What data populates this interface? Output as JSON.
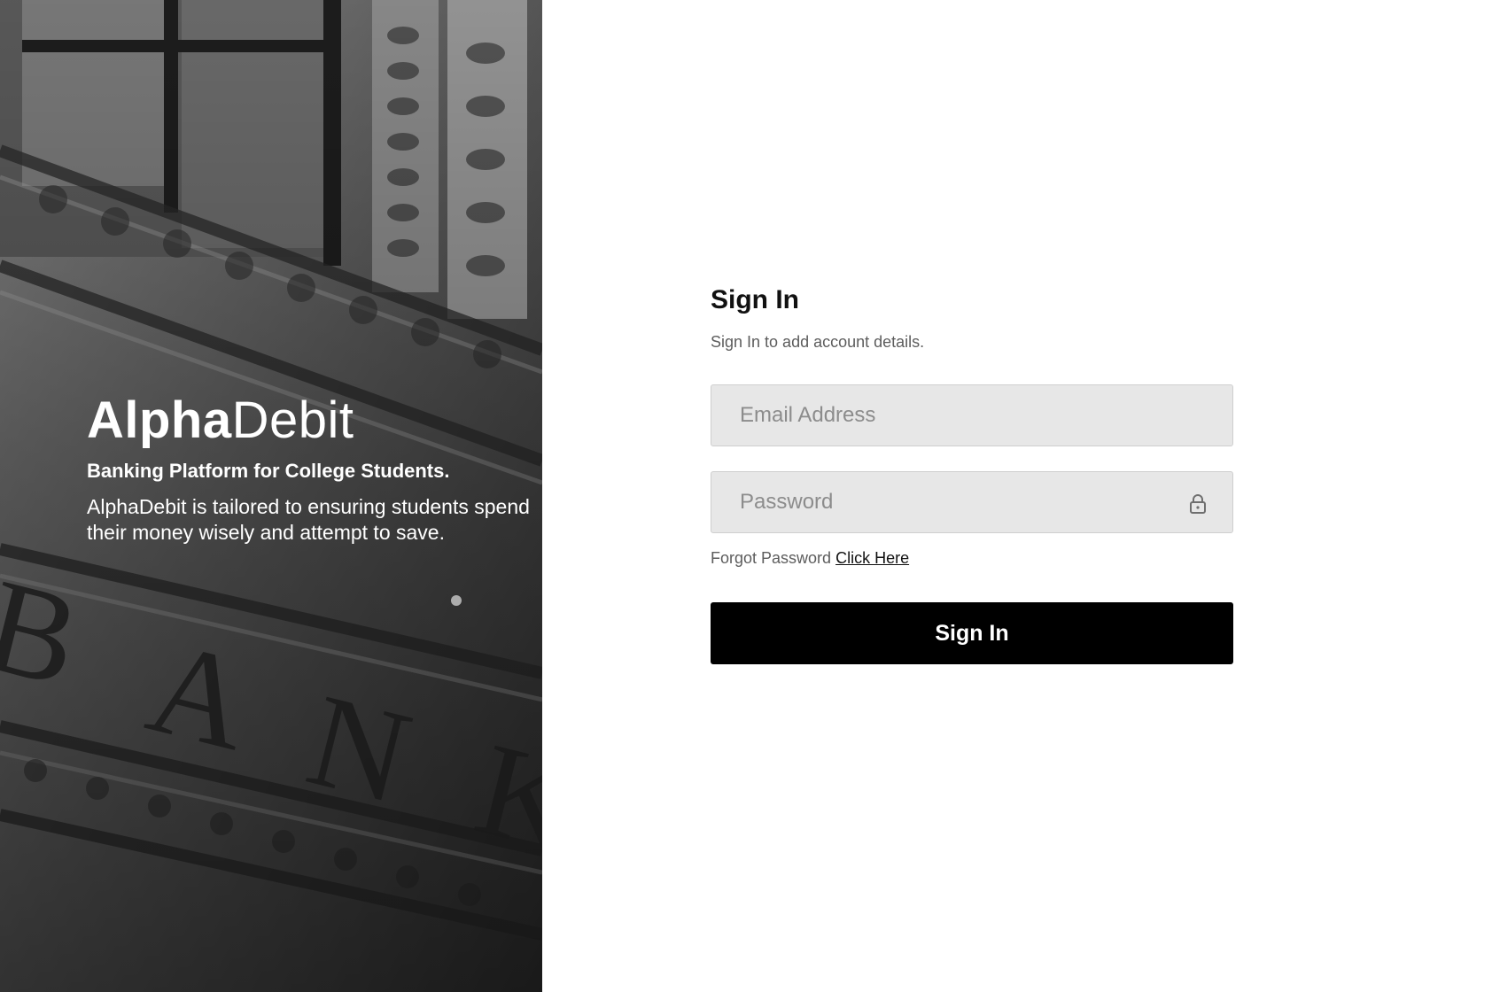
{
  "hero": {
    "brand_bold": "Alpha",
    "brand_light": "Debit",
    "tagline": "Banking Platform for College Students.",
    "description": "AlphaDebit is tailored to ensuring students spend their money wisely and attempt to save.",
    "photo_letters": [
      "B",
      "A",
      "N",
      "K"
    ]
  },
  "signin": {
    "title": "Sign In",
    "subtitle": "Sign In to add account details.",
    "email_placeholder": "Email Address",
    "password_placeholder": "Password",
    "password_icon": "lock-icon",
    "forgot_text": "Forgot Password",
    "forgot_link": "Click Here",
    "button_label": "Sign In"
  },
  "colors": {
    "button_bg": "#000000",
    "field_bg": "#e7e7e7",
    "page_bg": "#ffffff"
  }
}
